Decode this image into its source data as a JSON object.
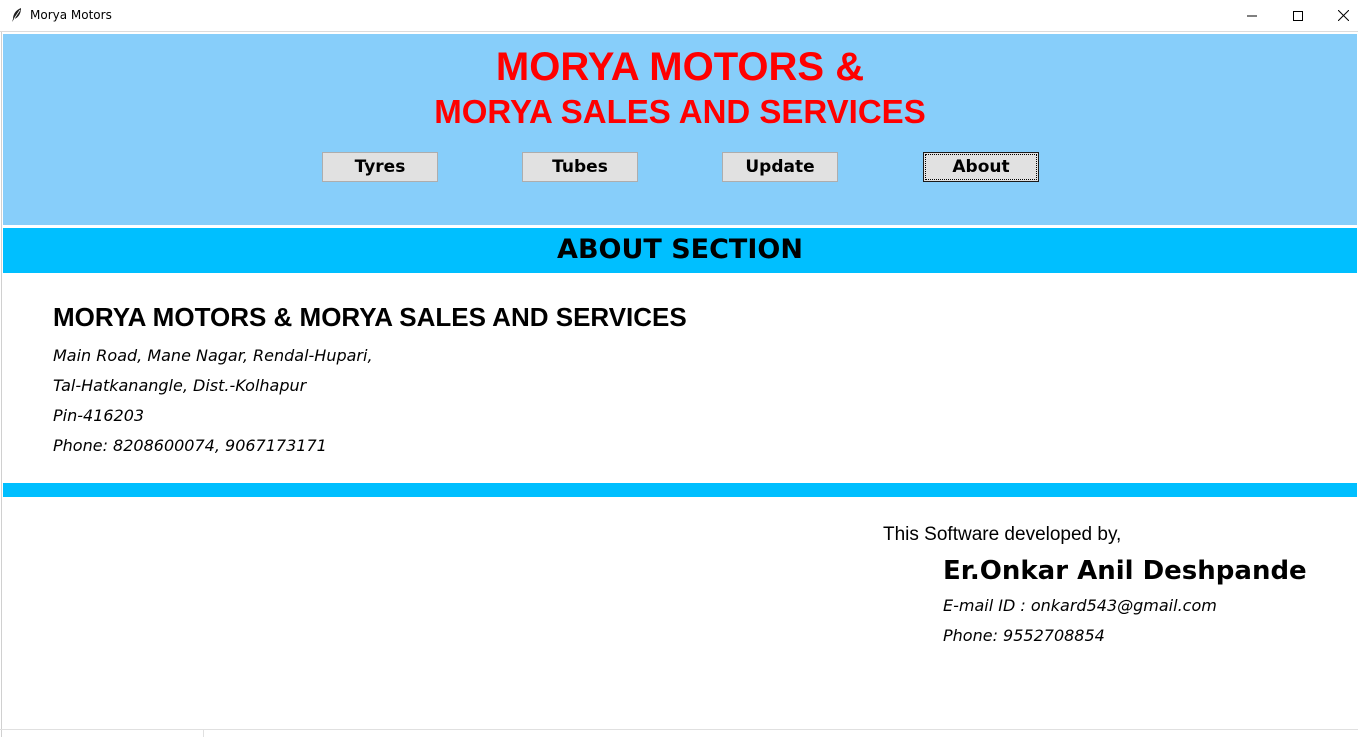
{
  "window": {
    "title": "Morya Motors",
    "icon": "feather-icon",
    "controls": [
      "minimize-icon",
      "maximize-icon",
      "close-icon"
    ]
  },
  "header": {
    "title_line1": "MORYA MOTORS &",
    "title_line2": "MORYA SALES AND SERVICES",
    "title_color": "#ff0000",
    "background": "#87cefa"
  },
  "nav": {
    "tyres": "Tyres",
    "tubes": "Tubes",
    "update": "Update",
    "about": "About",
    "active": "About"
  },
  "section": {
    "title": "ABOUT SECTION",
    "background": "#00bfff"
  },
  "company": {
    "name": "MORYA MOTORS & MORYA SALES AND SERVICES",
    "address_line1": "Main Road, Mane Nagar, Rendal-Hupari,",
    "address_line2": "Tal-Hatkanangle, Dist.-Kolhapur",
    "pin": "Pin-416203",
    "phone": "Phone: 8208600074, 9067173171"
  },
  "developer": {
    "intro": "This Software developed by,",
    "name": "Er.Onkar Anil Deshpande",
    "email": "E-mail ID : onkard543@gmail.com",
    "phone": "Phone: 9552708854"
  }
}
